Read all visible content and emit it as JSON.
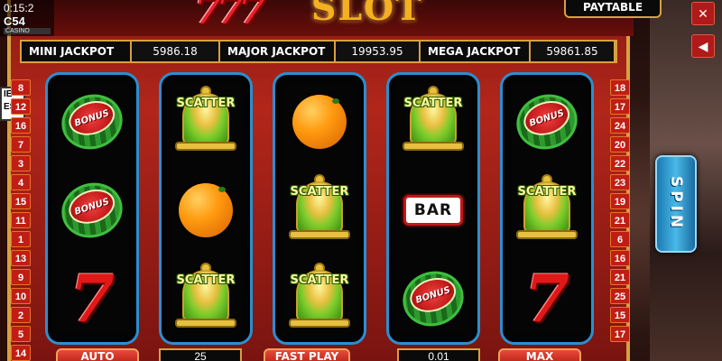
{
  "title": "SLOT",
  "logo_text": "777",
  "status": {
    "clock": "0:15:2",
    "brand": "C54",
    "brand_sub": "CASINO"
  },
  "paytable_label": "PAYTABLE",
  "corner_buttons": {
    "fullscreen_icon": "✕",
    "sound_icon": "◀"
  },
  "jackpots": [
    {
      "label": "MINI JACKPOT",
      "value": "5986.18"
    },
    {
      "label": "MAJOR JACKPOT",
      "value": "19953.95"
    },
    {
      "label": "MEGA JACKPOT",
      "value": "59861.85"
    }
  ],
  "side_box_text": "IE\nES",
  "left_lines": [
    "8",
    "12",
    "16",
    "7",
    "3",
    "4",
    "15",
    "11",
    "1",
    "13",
    "9",
    "10",
    "2",
    "5",
    "14"
  ],
  "right_lines": [
    "18",
    "17",
    "24",
    "20",
    "22",
    "23",
    "19",
    "21",
    "6",
    "16",
    "21",
    "25",
    "15",
    "17"
  ],
  "reels": [
    [
      {
        "type": "melon",
        "label": "BONUS"
      },
      {
        "type": "melon",
        "label": "BONUS"
      },
      {
        "type": "seven",
        "label": "7"
      }
    ],
    [
      {
        "type": "bell",
        "label": "SCATTER"
      },
      {
        "type": "orange",
        "label": ""
      },
      {
        "type": "bell",
        "label": "SCATTER"
      }
    ],
    [
      {
        "type": "orange",
        "label": ""
      },
      {
        "type": "bell",
        "label": "SCATTER"
      },
      {
        "type": "bell",
        "label": "SCATTER"
      }
    ],
    [
      {
        "type": "bell",
        "label": "SCATTER"
      },
      {
        "type": "bar",
        "label": "BAR"
      },
      {
        "type": "melon",
        "label": "BONUS"
      }
    ],
    [
      {
        "type": "melon",
        "label": "BONUS"
      },
      {
        "type": "bell",
        "label": "SCATTER"
      },
      {
        "type": "seven",
        "label": "7"
      }
    ]
  ],
  "spin_label": "SPIN",
  "controls": {
    "auto_label": "AUTO",
    "lines_value": "25",
    "fast_play_label": "FAST PLAY",
    "bet_value": "0.01",
    "max_label": "MAX"
  },
  "colors": {
    "cabinet_red": "#b2261a",
    "reel_border": "#2a8fd0",
    "gold": "#d8a040",
    "spin_blue": "#4ab8e8"
  }
}
